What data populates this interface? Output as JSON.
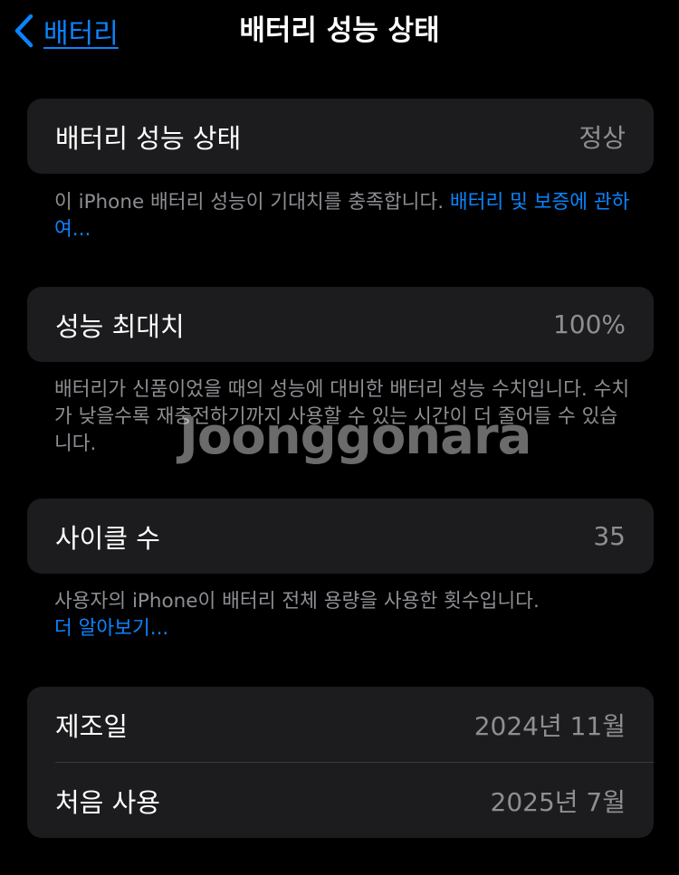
{
  "nav": {
    "back_label": "배터리",
    "title": "배터리 성능 상태"
  },
  "battery_health": {
    "label": "배터리 성능 상태",
    "value": "정상",
    "note": "이 iPhone 배터리 성능이 기대치를 충족합니다. ",
    "note_link": "배터리 및 보증에 관하여..."
  },
  "max_capacity": {
    "label": "성능 최대치",
    "value": "100%",
    "note": "배터리가 신품이었을 때의 성능에 대비한 배터리 성능 수치입니다. 수치가 낮을수록 재충전하기까지 사용할 수 있는 시간이 더 줄어들 수 있습니다."
  },
  "cycle_count": {
    "label": "사이클 수",
    "value": "35",
    "note": "사용자의 iPhone이 배터리 전체 용량을 사용한 횟수입니다.",
    "note_link": "더 알아보기..."
  },
  "dates": {
    "manufacture_label": "제조일",
    "manufacture_value": "2024년 11월",
    "first_use_label": "처음 사용",
    "first_use_value": "2025년 7월"
  },
  "watermark": "Joonggonara",
  "colors": {
    "background": "#000000",
    "card": "#1c1c1e",
    "accent": "#0a84ff",
    "secondary_text": "#8e8e93"
  }
}
